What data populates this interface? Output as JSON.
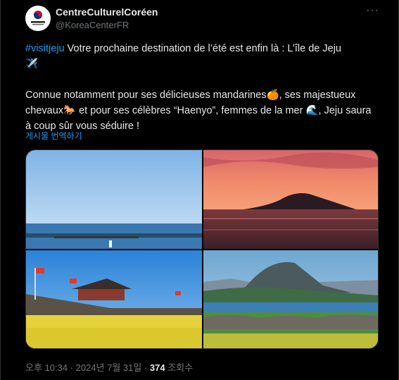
{
  "account": {
    "name": "CentreCulturelCoréen",
    "handle": "@KoreaCenterFR"
  },
  "tweet": {
    "line1_hashtag": "#visitjeju",
    "line1_rest": " Votre prochaine destination de l’été est enfin là : L’île de Jeju",
    "line1_emoji": "✈️",
    "para2_a": "Connue notamment pour ses délicieuses mandarines",
    "emoji_orange": "🍊",
    "para2_b": ", ses majestueux chevaux",
    "emoji_horse": "🐎",
    "para2_c": " et pour ses célèbres “Haenyo”, femmes de la mer ",
    "emoji_wave": "🌊",
    "para2_d": ", Jeju saura à coup sûr vous séduire !"
  },
  "translate_label": "게시물 번역하기",
  "meta": {
    "timestamp": "오후 10:34 · 2024년 7월 31일 · ",
    "views_count": "374",
    "views_label": " 조회수"
  },
  "icons": {
    "more": "more-options-icon"
  },
  "colors": {
    "background": "#000000",
    "text": "#e7e9ea",
    "muted": "#71767b",
    "link": "#1d9bf0"
  }
}
